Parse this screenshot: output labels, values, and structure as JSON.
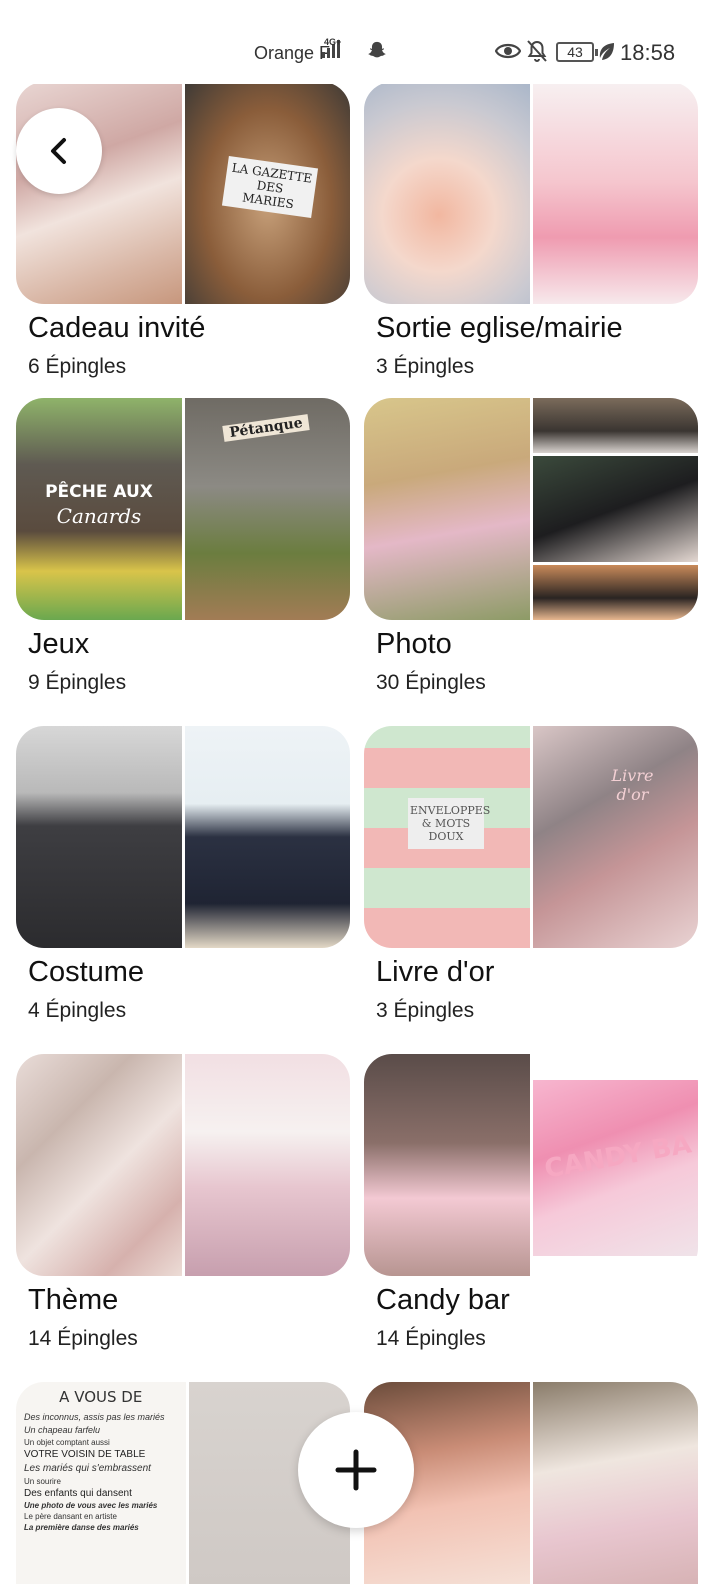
{
  "status_bar": {
    "carrier": "Orange F",
    "network": "4G+",
    "battery": "43",
    "time": "18:58"
  },
  "boards": [
    {
      "title": "Cadeau invité",
      "count": "6 Épingles"
    },
    {
      "title": "Sortie eglise/mairie",
      "count": "3 Épingles"
    },
    {
      "title": "Jeux",
      "count": "9 Épingles"
    },
    {
      "title": "Photo",
      "count": "30 Épingles"
    },
    {
      "title": "Costume",
      "count": "4 Épingles"
    },
    {
      "title": "Livre d'or",
      "count": "3 Épingles"
    },
    {
      "title": "Thème",
      "count": "14 Épingles"
    },
    {
      "title": "Candy bar",
      "count": "14 Épingles"
    }
  ],
  "cover_text": {
    "gazette": "LA GAZETTE DES MARIES",
    "peche": "PÊCHE AUX",
    "canards": "Canards",
    "petanque": "Pétanque",
    "enveloppes": "ENVELOPPES & MOTS DOUX",
    "livre": "Livre d'or",
    "candy": "CANDY BA",
    "avous": "A VOUS DE",
    "avous_lines": [
      "Des inconnus, assis pas les mariés",
      "Un chapeau farfelu",
      "Un objet comptant aussi",
      "VOTRE VOISIN DE TABLE",
      "Les mariés qui s'embrassent",
      "Un sourire",
      "Des enfants qui dansent",
      "Une photo de vous avec les mariés",
      "Le père dansant en artiste",
      "La première danse des mariés"
    ]
  },
  "icons": {
    "back": "chevron-left-icon",
    "add": "plus-icon"
  }
}
